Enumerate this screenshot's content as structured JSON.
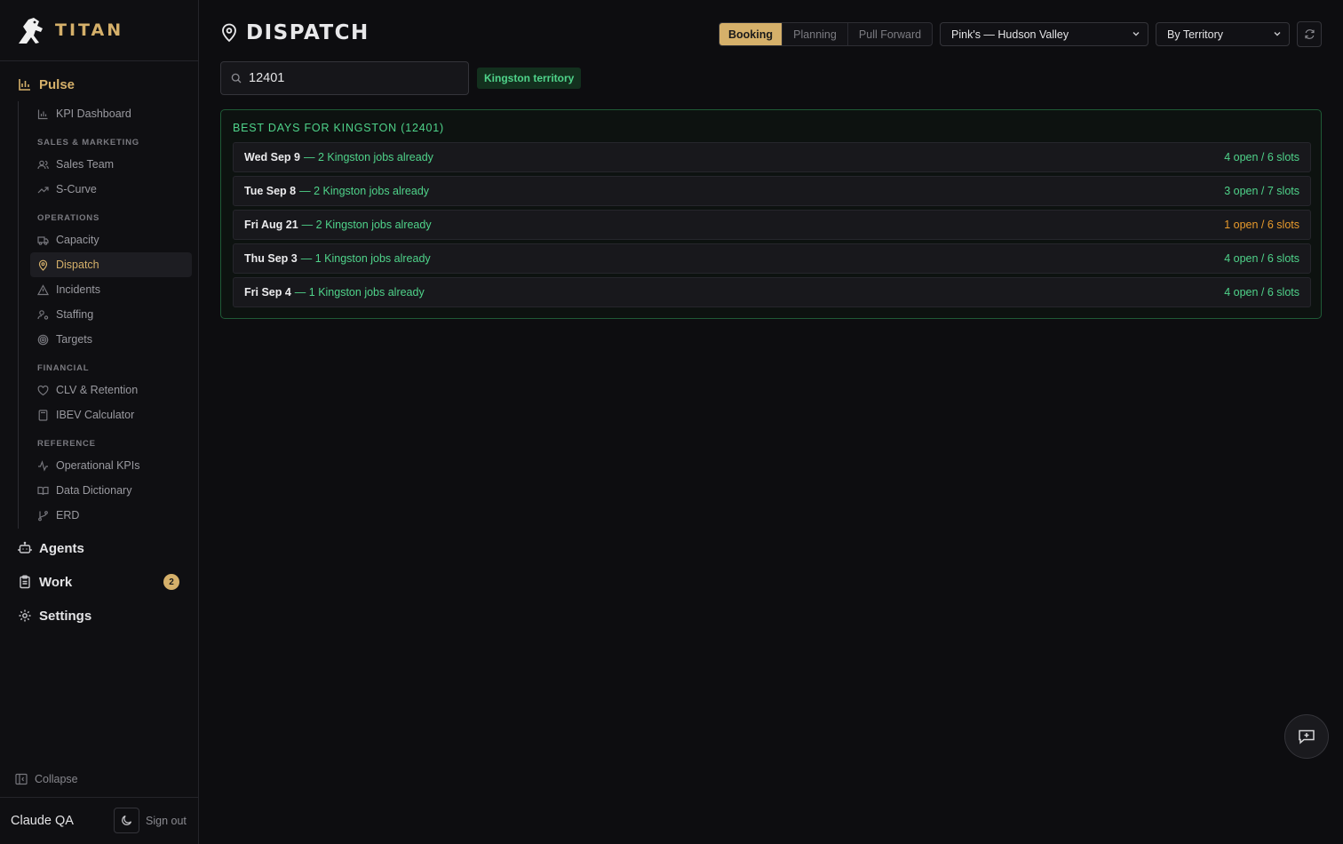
{
  "brand": {
    "name": "TITAN"
  },
  "sidebar": {
    "pulse_label": "Pulse",
    "items": {
      "kpi_dashboard": "KPI Dashboard",
      "sales_marketing_head": "SALES & MARKETING",
      "sales_team": "Sales Team",
      "s_curve": "S-Curve",
      "operations_head": "OPERATIONS",
      "capacity": "Capacity",
      "dispatch": "Dispatch",
      "incidents": "Incidents",
      "staffing": "Staffing",
      "targets": "Targets",
      "financial_head": "FINANCIAL",
      "clv_retention": "CLV & Retention",
      "ibev_calculator": "IBEV Calculator",
      "reference_head": "REFERENCE",
      "operational_kpis": "Operational KPIs",
      "data_dictionary": "Data Dictionary",
      "erd": "ERD"
    },
    "agents_label": "Agents",
    "work_label": "Work",
    "work_badge": "2",
    "settings_label": "Settings",
    "collapse_label": "Collapse",
    "user_name": "Claude QA",
    "sign_out_label": "Sign out"
  },
  "header": {
    "title": "DISPATCH",
    "modes": [
      "Booking",
      "Planning",
      "Pull Forward"
    ],
    "active_mode": "Booking",
    "location_select": "Pink's — Hudson Valley",
    "grouping_select": "By Territory"
  },
  "search": {
    "value": "12401",
    "territory_tag": "Kingston territory"
  },
  "best_days": {
    "title": "BEST DAYS FOR KINGSTON (12401)",
    "rows": [
      {
        "day": "Wed Sep 9",
        "desc": "— 2 Kingston jobs already",
        "slots": "4 open / 6 slots",
        "status": "ok"
      },
      {
        "day": "Tue Sep 8",
        "desc": "— 2 Kingston jobs already",
        "slots": "3 open / 7 slots",
        "status": "ok"
      },
      {
        "day": "Fri Aug 21",
        "desc": "— 2 Kingston jobs already",
        "slots": "1 open / 6 slots",
        "status": "warn"
      },
      {
        "day": "Thu Sep 3",
        "desc": "— 1 Kingston jobs already",
        "slots": "4 open / 6 slots",
        "status": "ok"
      },
      {
        "day": "Fri Sep 4",
        "desc": "— 1 Kingston jobs already",
        "slots": "4 open / 6 slots",
        "status": "ok"
      }
    ]
  },
  "colors": {
    "accent": "#d5b06a",
    "success": "#4fd38a",
    "warning": "#e89a2c",
    "background": "#0d0d10"
  }
}
